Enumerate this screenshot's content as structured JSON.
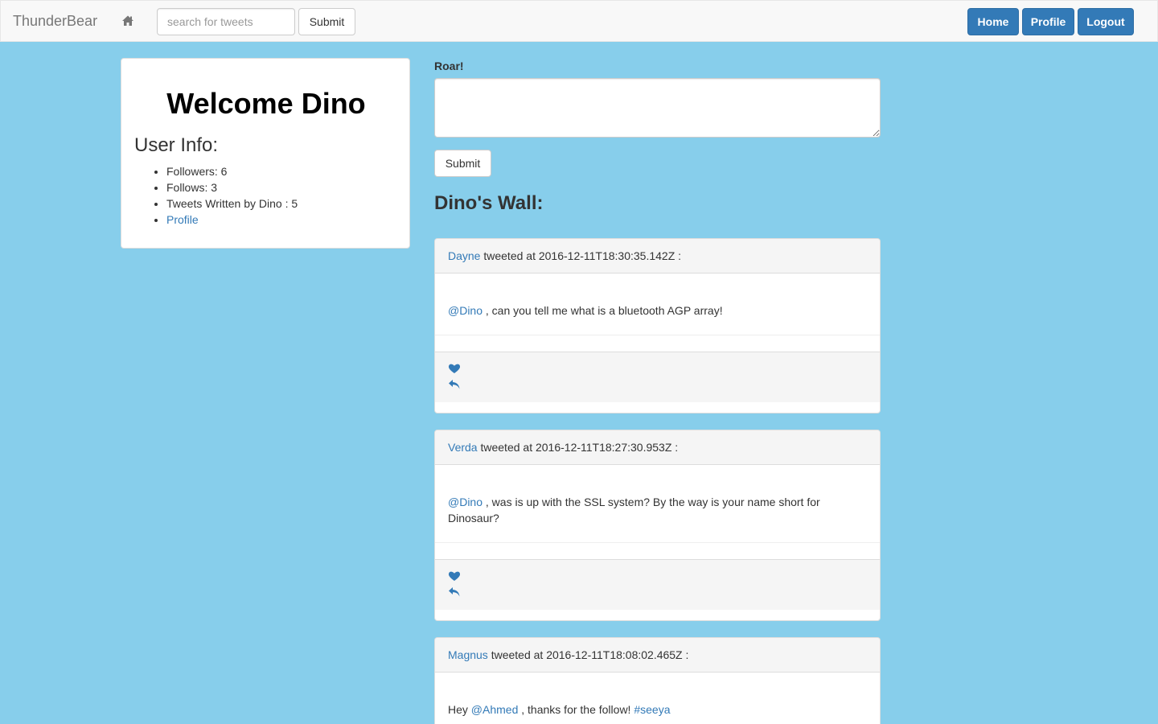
{
  "navbar": {
    "brand": "ThunderBear",
    "search_placeholder": "search for tweets",
    "search_submit": "Submit",
    "home": "Home",
    "profile": "Profile",
    "logout": "Logout"
  },
  "welcome": {
    "title": "Welcome Dino",
    "user_info_heading": "User Info:",
    "followers": "Followers: 6",
    "follows": "Follows: 3",
    "tweets_written": "Tweets Written by Dino : 5",
    "profile_link": "Profile"
  },
  "compose": {
    "label": "Roar!",
    "submit": "Submit"
  },
  "wall": {
    "title": "Dino's Wall:",
    "tweets": [
      {
        "author": "Dayne",
        "meta": " tweeted at 2016-12-11T18:30:35.142Z :",
        "mention": "@Dino",
        "text": " , can you tell me what is a bluetooth AGP array!"
      },
      {
        "author": "Verda",
        "meta": " tweeted at 2016-12-11T18:27:30.953Z :",
        "mention": "@Dino",
        "text": " , was is up with the SSL system? By the way is your name short for Dinosaur?"
      },
      {
        "author": "Magnus",
        "meta": " tweeted at 2016-12-11T18:08:02.465Z :",
        "prefix": "Hey ",
        "mention": "@Ahmed",
        "text": " , thanks for the follow! ",
        "hashtag": "#seeya"
      }
    ]
  },
  "icons": {
    "home": "home-icon",
    "like": "heart-icon",
    "reply": "reply-icon"
  },
  "colors": {
    "background": "#87ceeb",
    "primary": "#337ab7",
    "link": "#337ab7"
  }
}
